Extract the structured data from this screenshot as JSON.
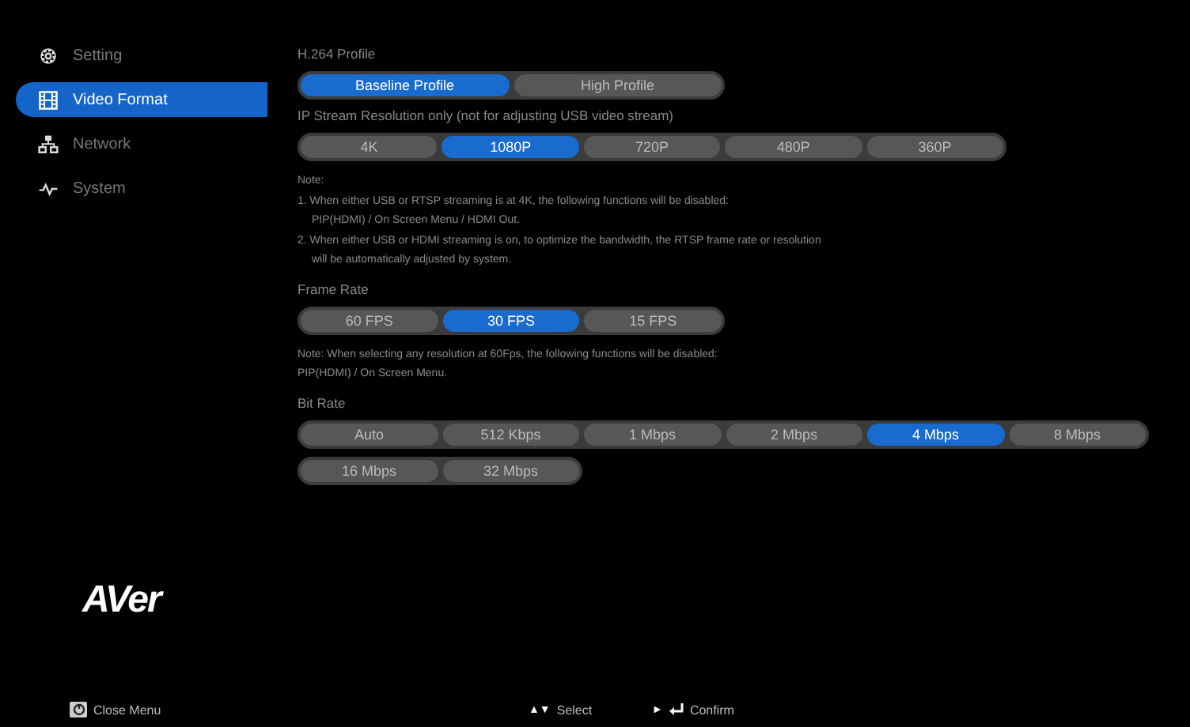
{
  "sidebar": {
    "items": [
      {
        "label": "Setting",
        "selected": false
      },
      {
        "label": "Video Format",
        "selected": true
      },
      {
        "label": "Network",
        "selected": false
      },
      {
        "label": "System",
        "selected": false
      }
    ]
  },
  "sections": [
    {
      "kind": "options",
      "label": "H.264 Profile",
      "rows": [
        [
          {
            "label": "Baseline Profile",
            "selected": true
          },
          {
            "label": "High Profile",
            "selected": false
          }
        ]
      ]
    },
    {
      "kind": "options",
      "label": "IP Stream Resolution only (not for adjusting USB video stream)",
      "rows": [
        [
          {
            "label": "4K",
            "selected": false
          },
          {
            "label": "1080P",
            "selected": true
          },
          {
            "label": "720P",
            "selected": false
          },
          {
            "label": "480P",
            "selected": false
          },
          {
            "label": "360P",
            "selected": false
          }
        ]
      ]
    },
    {
      "kind": "note",
      "heading": "Note:",
      "items": [
        {
          "lines": [
            "1. When either USB or RTSP streaming is at 4K, the following functions will be disabled:",
            "PIP(HDMI) / On Screen Menu / HDMI Out."
          ]
        },
        {
          "lines": [
            "2. When either USB or HDMI streaming is on, to optimize the bandwidth, the RTSP frame rate or resolution",
            "will be automatically adjusted by system."
          ]
        }
      ]
    },
    {
      "kind": "options",
      "label": "Frame Rate",
      "rows": [
        [
          {
            "label": "60 FPS",
            "selected": false
          },
          {
            "label": "30 FPS",
            "selected": true
          },
          {
            "label": "15 FPS",
            "selected": false
          }
        ]
      ]
    },
    {
      "kind": "plain-note",
      "lines": [
        "Note: When selecting any resolution at 60Fps, the following functions will be disabled:",
        "PIP(HDMI) / On Screen Menu."
      ]
    },
    {
      "kind": "options",
      "label": "Bit Rate",
      "rows": [
        [
          {
            "label": "Auto",
            "selected": false
          },
          {
            "label": "512 Kbps",
            "selected": false
          },
          {
            "label": "1 Mbps",
            "selected": false
          },
          {
            "label": "2 Mbps",
            "selected": false
          },
          {
            "label": "4 Mbps",
            "selected": true
          },
          {
            "label": "8 Mbps",
            "selected": false
          }
        ],
        [
          {
            "label": "16 Mbps",
            "selected": false
          },
          {
            "label": "32 Mbps",
            "selected": false
          }
        ]
      ]
    }
  ],
  "logo": "AVer",
  "footer": {
    "close": "Close Menu",
    "select_keys": "▲▼",
    "select": "Select",
    "confirm_key": "►",
    "confirm": "Confirm"
  }
}
